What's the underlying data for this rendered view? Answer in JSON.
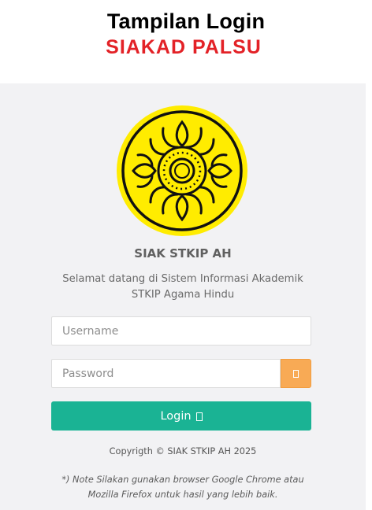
{
  "header": {
    "title": "Tampilan Login",
    "subtitle": "SIAKAD PALSU"
  },
  "app": {
    "name": "SIAK STKIP AH",
    "welcome_line1": "Selamat datang di Sistem Informasi Akademik",
    "welcome_line2": "STKIP Agama Hindu",
    "logo_icon": "institution-emblem-icon"
  },
  "form": {
    "username_placeholder": "Username",
    "password_placeholder": "Password",
    "toggle_icon": "eye-icon",
    "login_label": "Login",
    "login_icon": "sign-in-icon"
  },
  "footer": {
    "copyright": "Copyrigth © SIAK STKIP AH 2025",
    "note_line1": "*) Note Silakan gunakan browser Google Chrome atau",
    "note_line2": "Mozilla Firefox untuk hasil yang lebih baik."
  },
  "colors": {
    "panel_bg": "#f2f2f4",
    "subtitle_red": "#e32227",
    "toggle_orange": "#f8aa55",
    "login_green": "#1ab394",
    "logo_yellow": "#ffec00"
  }
}
